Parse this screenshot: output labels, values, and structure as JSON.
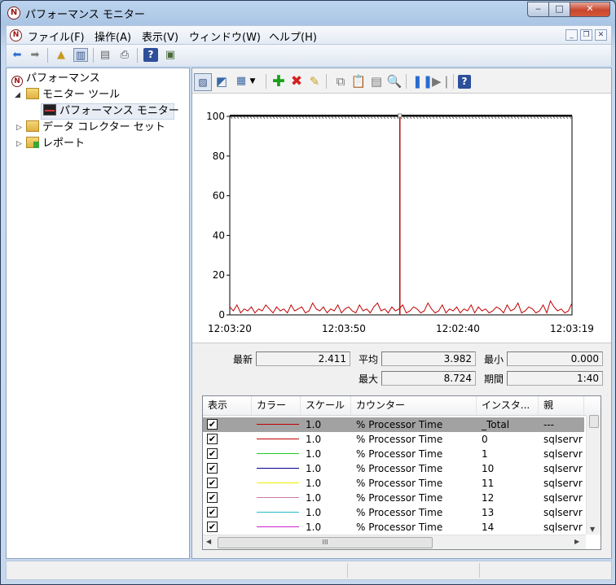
{
  "window": {
    "title": "パフォーマンス モニター"
  },
  "menu": [
    "ファイル(F)",
    "操作(A)",
    "表示(V)",
    "ウィンドウ(W)",
    "ヘルプ(H)"
  ],
  "tree": {
    "root": "パフォーマンス",
    "monitor_tools": "モニター ツール",
    "perf_monitor": "パフォーマンス モニター",
    "data_collector": "データ コレクター セット",
    "reports": "レポート"
  },
  "graph": {
    "y_ticks": [
      "100",
      "80",
      "60",
      "40",
      "20",
      "0"
    ],
    "x_ticks": [
      "12:03:20",
      "12:03:50",
      "12:02:40",
      "12:03:19"
    ]
  },
  "chart_data": {
    "type": "line",
    "x_ticks": [
      "12:03:20",
      "12:03:50",
      "12:02:40",
      "12:03:19"
    ],
    "ylim": [
      0,
      100
    ],
    "series": [
      {
        "color": "#c00000",
        "values": [
          4,
          2,
          5,
          1,
          3,
          2,
          4,
          1,
          3,
          2,
          5,
          3,
          1,
          4,
          2,
          3,
          1,
          5,
          2,
          3,
          4,
          1,
          2,
          6,
          3,
          2,
          4,
          1,
          3,
          2,
          5,
          1,
          3,
          4,
          2,
          1,
          5,
          2,
          3,
          1,
          4,
          6,
          2,
          3,
          1,
          4,
          2,
          3,
          5,
          1,
          2,
          4,
          3,
          1,
          2,
          6,
          3,
          1,
          2,
          5,
          1,
          3,
          2,
          4,
          1,
          3,
          2,
          5,
          1,
          4,
          2,
          3,
          1,
          2,
          4,
          3,
          1,
          5,
          2,
          3,
          6,
          1,
          2,
          4,
          3,
          1,
          2,
          5,
          1,
          7,
          4,
          2,
          3,
          1,
          2,
          6
        ]
      }
    ]
  },
  "stats": {
    "last_label": "最新",
    "last_value": "2.411",
    "avg_label": "平均",
    "avg_value": "3.982",
    "min_label": "最小",
    "min_value": "0.000",
    "max_label": "最大",
    "max_value": "8.724",
    "duration_label": "期間",
    "duration_value": "1:40"
  },
  "list": {
    "headers": [
      "表示",
      "カラー",
      "スケール",
      "カウンター",
      "インスタ...",
      "親"
    ],
    "rows": [
      {
        "color": "#c00000",
        "scale": "1.0",
        "counter": "% Processor Time",
        "instance": "_Total",
        "parent": "---"
      },
      {
        "color": "#c00000",
        "scale": "1.0",
        "counter": "% Processor Time",
        "instance": "0",
        "parent": "sqlservr"
      },
      {
        "color": "#22cc22",
        "scale": "1.0",
        "counter": "% Processor Time",
        "instance": "1",
        "parent": "sqlservr"
      },
      {
        "color": "#000090",
        "scale": "1.0",
        "counter": "% Processor Time",
        "instance": "10",
        "parent": "sqlservr"
      },
      {
        "color": "#eeee00",
        "scale": "1.0",
        "counter": "% Processor Time",
        "instance": "11",
        "parent": "sqlservr"
      },
      {
        "color": "#cc77aa",
        "scale": "1.0",
        "counter": "% Processor Time",
        "instance": "12",
        "parent": "sqlservr"
      },
      {
        "color": "#22bbcc",
        "scale": "1.0",
        "counter": "% Processor Time",
        "instance": "13",
        "parent": "sqlservr"
      },
      {
        "color": "#cc22cc",
        "scale": "1.0",
        "counter": "% Processor Time",
        "instance": "14",
        "parent": "sqlservr"
      }
    ]
  },
  "hscroll_grip": "III"
}
